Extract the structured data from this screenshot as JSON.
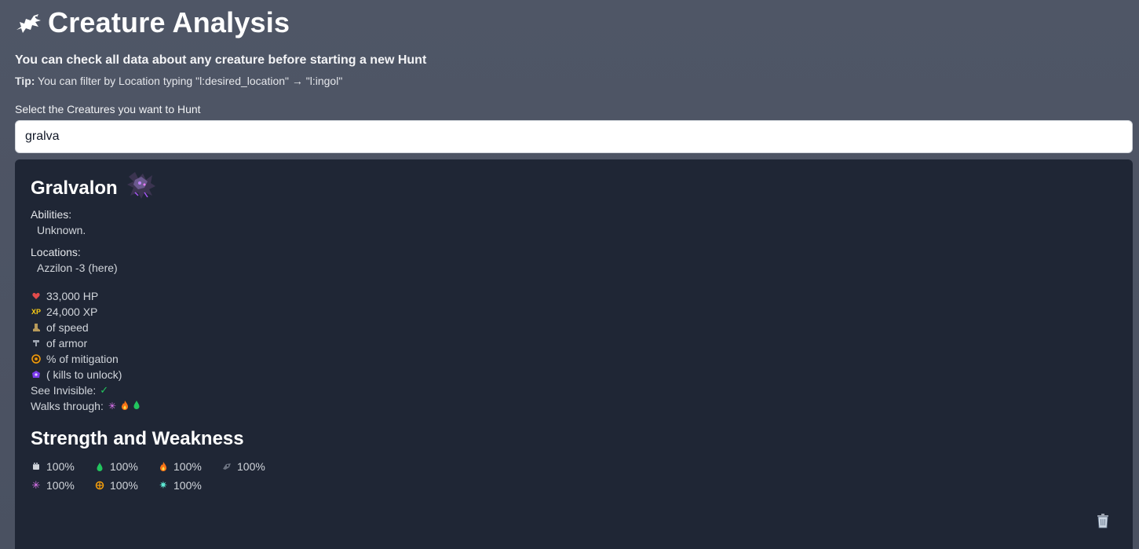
{
  "header": {
    "title": "Creature Analysis",
    "logo_icon": "dragon-icon",
    "subtitle": "You can check all data about any creature before starting a new Hunt",
    "tip_label": "Tip:",
    "tip_text": " You can filter by Location typing \"l:desired_location\" → \"l:ingol\""
  },
  "search": {
    "label": "Select the Creatures you want to Hunt",
    "value": "gralva"
  },
  "creature": {
    "name": "Gralvalon",
    "sprite": "creature-sprite",
    "abilities_label": "Abilities:",
    "abilities_value": "Unknown.",
    "locations_label": "Locations:",
    "locations_value": "Azzilon -3 (here)",
    "stats": {
      "hp": "33,000 HP",
      "xp": "24,000 XP",
      "speed": "of speed",
      "armor": "of armor",
      "mitigation": "% of mitigation",
      "bestiary": "( kills to unlock)"
    },
    "see_invisible_label": "See Invisible:",
    "see_invisible_value": "✓",
    "walks_through_label": "Walks through:",
    "walks_through": [
      "energy-field-icon",
      "fire-field-icon",
      "poison-field-icon"
    ]
  },
  "strength_weakness": {
    "title": "Strength and Weakness",
    "items": [
      {
        "icon": "physical-icon",
        "value": "100%"
      },
      {
        "icon": "earth-icon",
        "value": "100%"
      },
      {
        "icon": "fire-icon",
        "value": "100%"
      },
      {
        "icon": "death-icon",
        "value": "100%"
      },
      {
        "icon": "energy-icon",
        "value": "100%"
      },
      {
        "icon": "holy-icon",
        "value": "100%"
      },
      {
        "icon": "ice-icon",
        "value": "100%"
      }
    ]
  },
  "colors": {
    "page_bg": "#4f5666",
    "card_bg": "#1f2635",
    "check": "#22c55e"
  }
}
